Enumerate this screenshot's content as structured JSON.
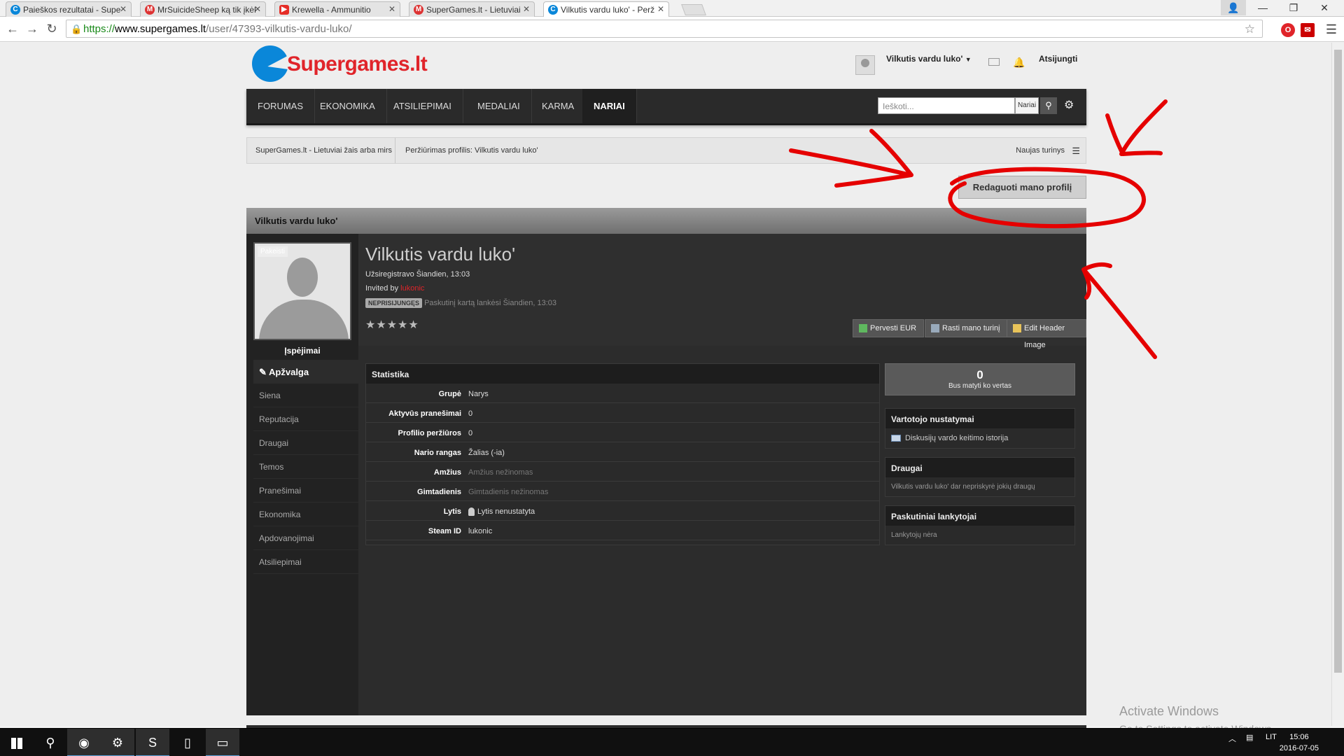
{
  "browser": {
    "tabs": [
      {
        "title": "Paieškos rezultatai - Supe",
        "favicon_color": "#0a87d9",
        "favicon": "C"
      },
      {
        "title": "MrSuicideSheep ką tik įkėl",
        "favicon_color": "#d33",
        "favicon": "M"
      },
      {
        "title": "Krewella - Ammunitio",
        "favicon_color": "#e52d27",
        "favicon": "▶"
      },
      {
        "title": "SuperGames.lt - Lietuviai",
        "favicon_color": "#d33",
        "favicon": "M"
      },
      {
        "title": "Vilkutis vardu luko' - Perž",
        "favicon_color": "#0a87d9",
        "favicon": "C"
      }
    ],
    "url": {
      "protocol": "https://",
      "host": "www.supergames.lt",
      "path": "/user/47393-vilkutis-vardu-luko/"
    }
  },
  "site": {
    "logo_text": "Supergames.lt",
    "brand_color": "#e0242a",
    "accent_color": "#0a87d9",
    "user_name": "Vilkutis vardu luko'",
    "logout": "Atsijungti"
  },
  "nav": {
    "items": [
      "FORUMAS",
      "EKONOMIKA",
      "ATSILIEPIMAI",
      "MEDALIAI",
      "KARMA",
      "NARIAI"
    ],
    "active": "NARIAI",
    "search_placeholder": "Ieškoti...",
    "search_scope": "Nariai"
  },
  "breadcrumb": {
    "items": [
      "SuperGames.lt - Lietuviai žais arba mirs",
      "Peržiūrimas profilis: Vilkutis vardu luko'"
    ],
    "new_content": "Naujas turinys"
  },
  "edit_profile_button": "Redaguoti mano profilį",
  "profile": {
    "header": "Vilkutis vardu luko'",
    "change_photo": "Pakeisti",
    "warnings": "Įspėjimai",
    "name": "Vilkutis vardu luko'",
    "registered": "Užsiregistravo Šiandien, 13:03",
    "invited_label": "Invited by",
    "invited_by": "lukonic",
    "status_badge": "NEPRISIJUNGĘS",
    "last_visit": "Paskutinį kartą lankėsi Šiandien, 13:03",
    "stars": "★★★★★",
    "actions": [
      "Pervesti EUR",
      "Rasti mano turinį",
      "Edit Header Image"
    ]
  },
  "sidenav": [
    "Apžvalga",
    "Siena",
    "Reputacija",
    "Draugai",
    "Temos",
    "Pranešimai",
    "Ekonomika",
    "Apdovanojimai",
    "Atsiliepimai"
  ],
  "stats": {
    "title": "Statistika",
    "rows": [
      {
        "key": "Grupė",
        "value": "Narys"
      },
      {
        "key": "Aktyvūs pranešimai",
        "value": "0"
      },
      {
        "key": "Profilio peržiūros",
        "value": "0"
      },
      {
        "key": "Nario rangas",
        "value": "Žalias (-ia)"
      },
      {
        "key": "Amžius",
        "value": "Amžius nežinomas"
      },
      {
        "key": "Gimtadienis",
        "value": "Gimtadienis nežinomas"
      },
      {
        "key": "Lytis",
        "value": "Lytis nenustatyta"
      },
      {
        "key": "Steam ID",
        "value": "lukonic"
      }
    ]
  },
  "sidebar_right": {
    "counter_value": "0",
    "counter_label": "Bus matyti ko vertas",
    "settings_title": "Vartotojo nustatymai",
    "settings_item": "Diskusijų vardo keitimo istorija",
    "friends_title": "Draugai",
    "friends_text": "Vilkutis vardu luko' dar nepriskyrė jokių draugų",
    "visitors_title": "Paskutiniai lankytojai",
    "visitors_text": "Lankytojų nėra"
  },
  "watermark": {
    "line1": "Activate Windows",
    "line2": "Go to Settings to activate Windows."
  },
  "taskbar": {
    "lang": "LIT",
    "time": "15:06",
    "date": "2016-07-05"
  }
}
